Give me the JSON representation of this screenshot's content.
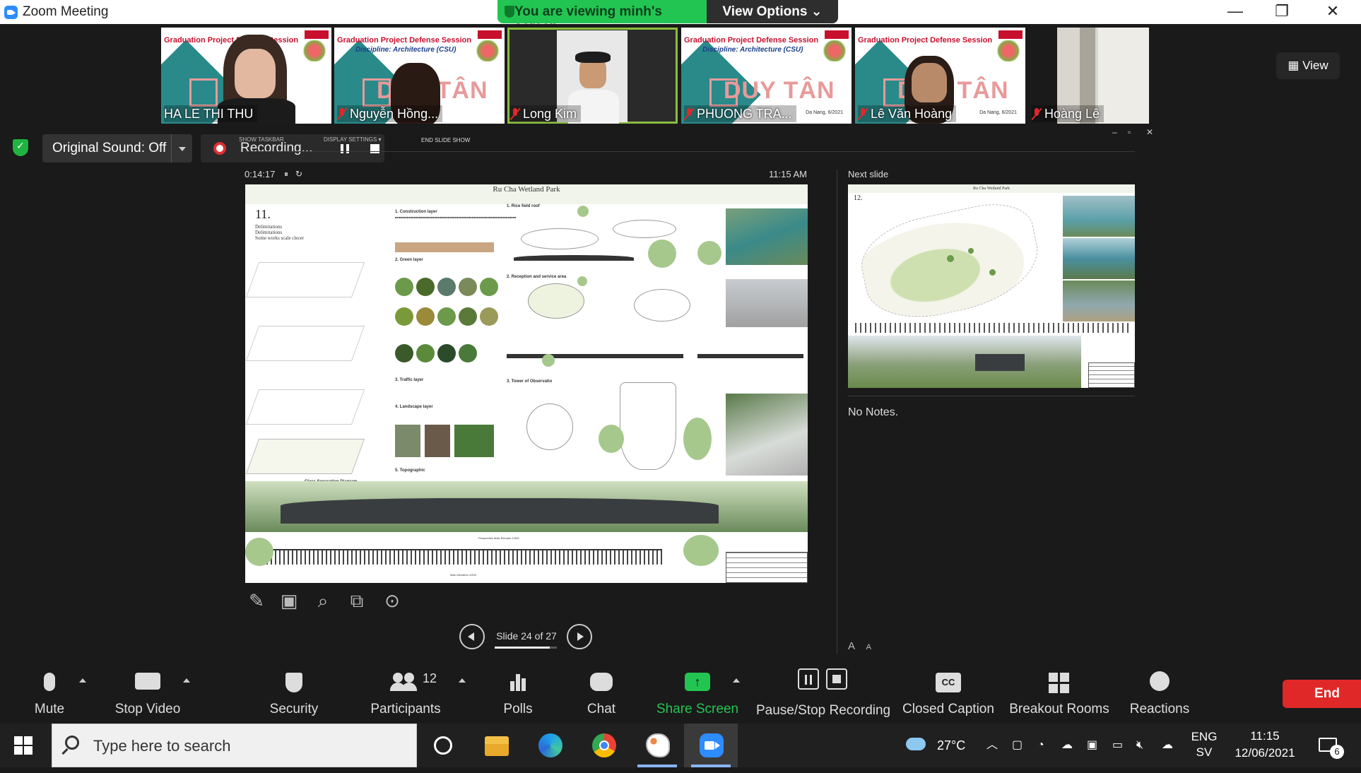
{
  "window": {
    "title": "Zoom Meeting",
    "viewing_banner": "You are viewing minh's screen",
    "view_options": "View Options ⌄"
  },
  "participants": [
    {
      "name": "HA LE THI THU",
      "muted": false,
      "video": true
    },
    {
      "name": "Nguyễn Hồng...",
      "muted": true,
      "video": true
    },
    {
      "name": "Long Kim",
      "muted": true,
      "video": true,
      "active_speaker": true
    },
    {
      "name": "PHUONG TRA...",
      "muted": true,
      "video": false
    },
    {
      "name": "Lê Văn Hoàng",
      "muted": true,
      "video": true
    },
    {
      "name": "Hoàng Lê",
      "muted": true,
      "video": true
    }
  ],
  "thumb_slide": {
    "banner": "Graduation Project Defense Session",
    "discipline": "Discipline: Architecture (CSU)",
    "logo_text": "DUY TÂN",
    "date": "Da Nang, 6/2021"
  },
  "view_button": "View",
  "recording_bar": {
    "original_sound": "Original Sound: Off",
    "recording_label": "Recording...",
    "show_taskbar": "SHOW TASKBAR",
    "display_settings": "DISPLAY SETTINGS ▾",
    "end_slide_show": "END SLIDE SHOW"
  },
  "presenter": {
    "elapsed": "0:14:17",
    "clock": "11:15 AM",
    "current_slide_title": "Ru Cha Wetland Park",
    "current_slide_number": "11.",
    "current_slide_sub": [
      "Delimitations",
      "Delimitations",
      "Some works scale clecer"
    ],
    "section_labels": [
      "1. Rice field roof",
      "2. Reception and service area",
      "3. Tower of Observatio",
      "1. Construction layer",
      "2. Green layer",
      "3. Traffic layer",
      "4. Landscape layer",
      "5. Topographic"
    ],
    "class_separation": "Class Separation Diagram",
    "perspective_label": "Perspective Main Elevator 1/300",
    "main_elevation_label": "Main elevation 1/200",
    "slide_counter": "Slide 24 of 27",
    "slide_index": 24,
    "slide_total": 27,
    "next_slide_label": "Next slide",
    "next_slide_title": "Ru Cha Wetland Park",
    "next_slide_number": "12.",
    "notes": "No Notes.",
    "font_up": "A",
    "font_down": "A"
  },
  "controls": {
    "mute": "Mute",
    "stop_video": "Stop Video",
    "security": "Security",
    "participants": "Participants",
    "participants_count": "12",
    "polls": "Polls",
    "chat": "Chat",
    "share_screen": "Share Screen",
    "pause_stop_recording": "Pause/Stop Recording",
    "closed_caption": "Closed Caption",
    "cc_icon_text": "CC",
    "breakout_rooms": "Breakout Rooms",
    "reactions": "Reactions",
    "end": "End"
  },
  "taskbar": {
    "search_placeholder": "Type here to search",
    "weather": "27°C",
    "lang1": "ENG",
    "lang2": "SV",
    "time": "11:15",
    "date": "12/06/2021",
    "notifications": "6"
  },
  "colors": {
    "zoom_blue": "#2d8cff",
    "viewing_green": "#23c552",
    "share_green": "#23c552",
    "end_red": "#e02828"
  }
}
